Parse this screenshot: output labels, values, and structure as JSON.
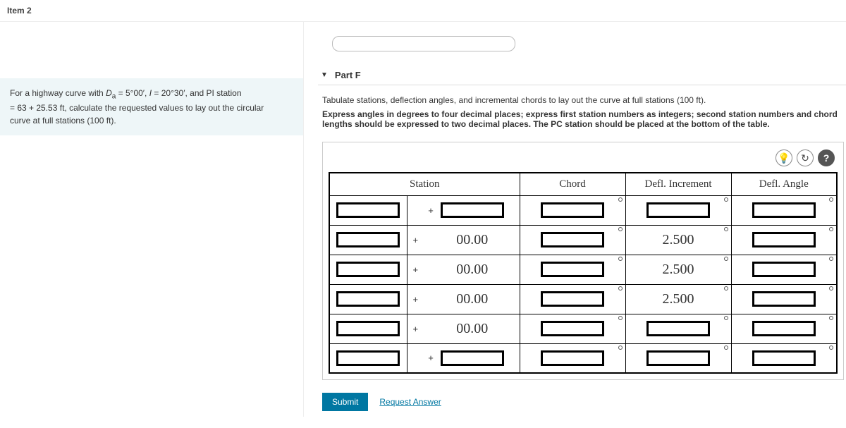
{
  "header": {
    "item_label": "Item 2"
  },
  "problem": {
    "line1_pre": "For a highway curve with ",
    "da_sym": "D",
    "da_sub": "a",
    "eq1": " = 5°00′, ",
    "i_sym": "I",
    "eq2": " = 20°30′, and PI station",
    "line2": "= 63 + 25.53 ft, calculate the requested values to lay out the circular",
    "line3": "curve at full stations (100 ft)."
  },
  "part": {
    "label": "Part F",
    "instr1": "Tabulate stations, deflection angles, and incremental chords to lay out the curve at full stations (100 ft).",
    "instr2": "Express angles in degrees to four decimal places; express first station numbers as integers; second station numbers and chord lengths should be expressed to two decimal places. The PC station should be placed at the bottom of the table."
  },
  "table": {
    "headers": {
      "station": "Station",
      "chord": "Chord",
      "defl_inc": "Defl. Increment",
      "defl_ang": "Defl. Angle"
    },
    "plus": "+",
    "rows": [
      {
        "station_b": "",
        "defl_inc": ""
      },
      {
        "station_b": "00.00",
        "defl_inc": "2.500"
      },
      {
        "station_b": "00.00",
        "defl_inc": "2.500"
      },
      {
        "station_b": "00.00",
        "defl_inc": "2.500"
      },
      {
        "station_b": "00.00",
        "defl_inc": ""
      },
      {
        "station_b": "",
        "defl_inc": ""
      }
    ]
  },
  "actions": {
    "submit": "Submit",
    "request": "Request Answer"
  },
  "tooltips": {
    "hint": "💡",
    "redo": "↻",
    "help": "?"
  }
}
